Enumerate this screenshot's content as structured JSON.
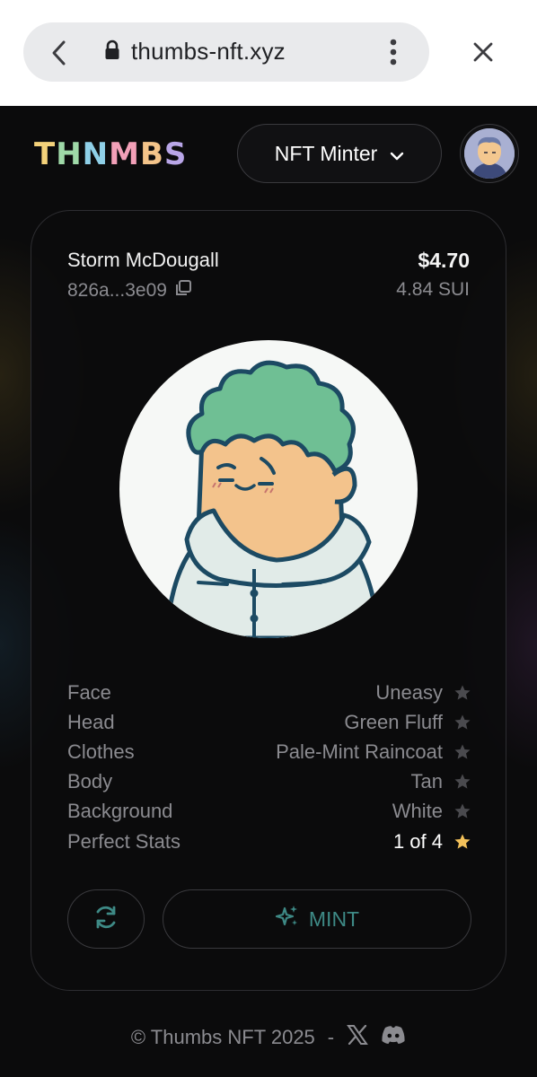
{
  "browser": {
    "url": "thumbs-nft.xyz",
    "icons": {
      "back": "back-arrow-icon",
      "lock": "lock-icon",
      "menu": "kebab-menu-icon",
      "close": "close-icon"
    }
  },
  "header": {
    "logo": [
      "T",
      "H",
      "N",
      "M",
      "B",
      "S"
    ],
    "logo_colors": [
      "#f4d27a",
      "#9fd9a8",
      "#8fd0e8",
      "#f2a0b8",
      "#f4c48a",
      "#b9a6e8"
    ],
    "menu_label": "NFT Minter",
    "menu_icon": "chevron-down-icon",
    "avatar_icon": "user-avatar"
  },
  "card": {
    "owner_name": "Storm McDougall",
    "owner_address": "826a...3e09",
    "copy_icon": "copy-icon",
    "price_usd": "$4.70",
    "price_sui": "4.84 SUI",
    "nft_image": "nft-character-image",
    "traits": [
      {
        "key": "Face",
        "value": "Uneasy",
        "star": false
      },
      {
        "key": "Head",
        "value": "Green Fluff",
        "star": false
      },
      {
        "key": "Clothes",
        "value": "Pale-Mint Raincoat",
        "star": false
      },
      {
        "key": "Body",
        "value": "Tan",
        "star": false
      },
      {
        "key": "Background",
        "value": "White",
        "star": false
      },
      {
        "key": "Perfect Stats",
        "value": "1 of 4",
        "star": true
      }
    ],
    "star_colors": {
      "inactive": "#4a4a4e",
      "active": "#f3c15a"
    },
    "refresh_icon": "refresh-icon",
    "mint_icon": "sparkles-icon",
    "mint_label": "MINT",
    "accent": "#3e8a86"
  },
  "footer": {
    "copyright": "© Thumbs NFT 2025",
    "separator": "-",
    "x_icon": "x-logo-icon",
    "discord_icon": "discord-icon"
  }
}
